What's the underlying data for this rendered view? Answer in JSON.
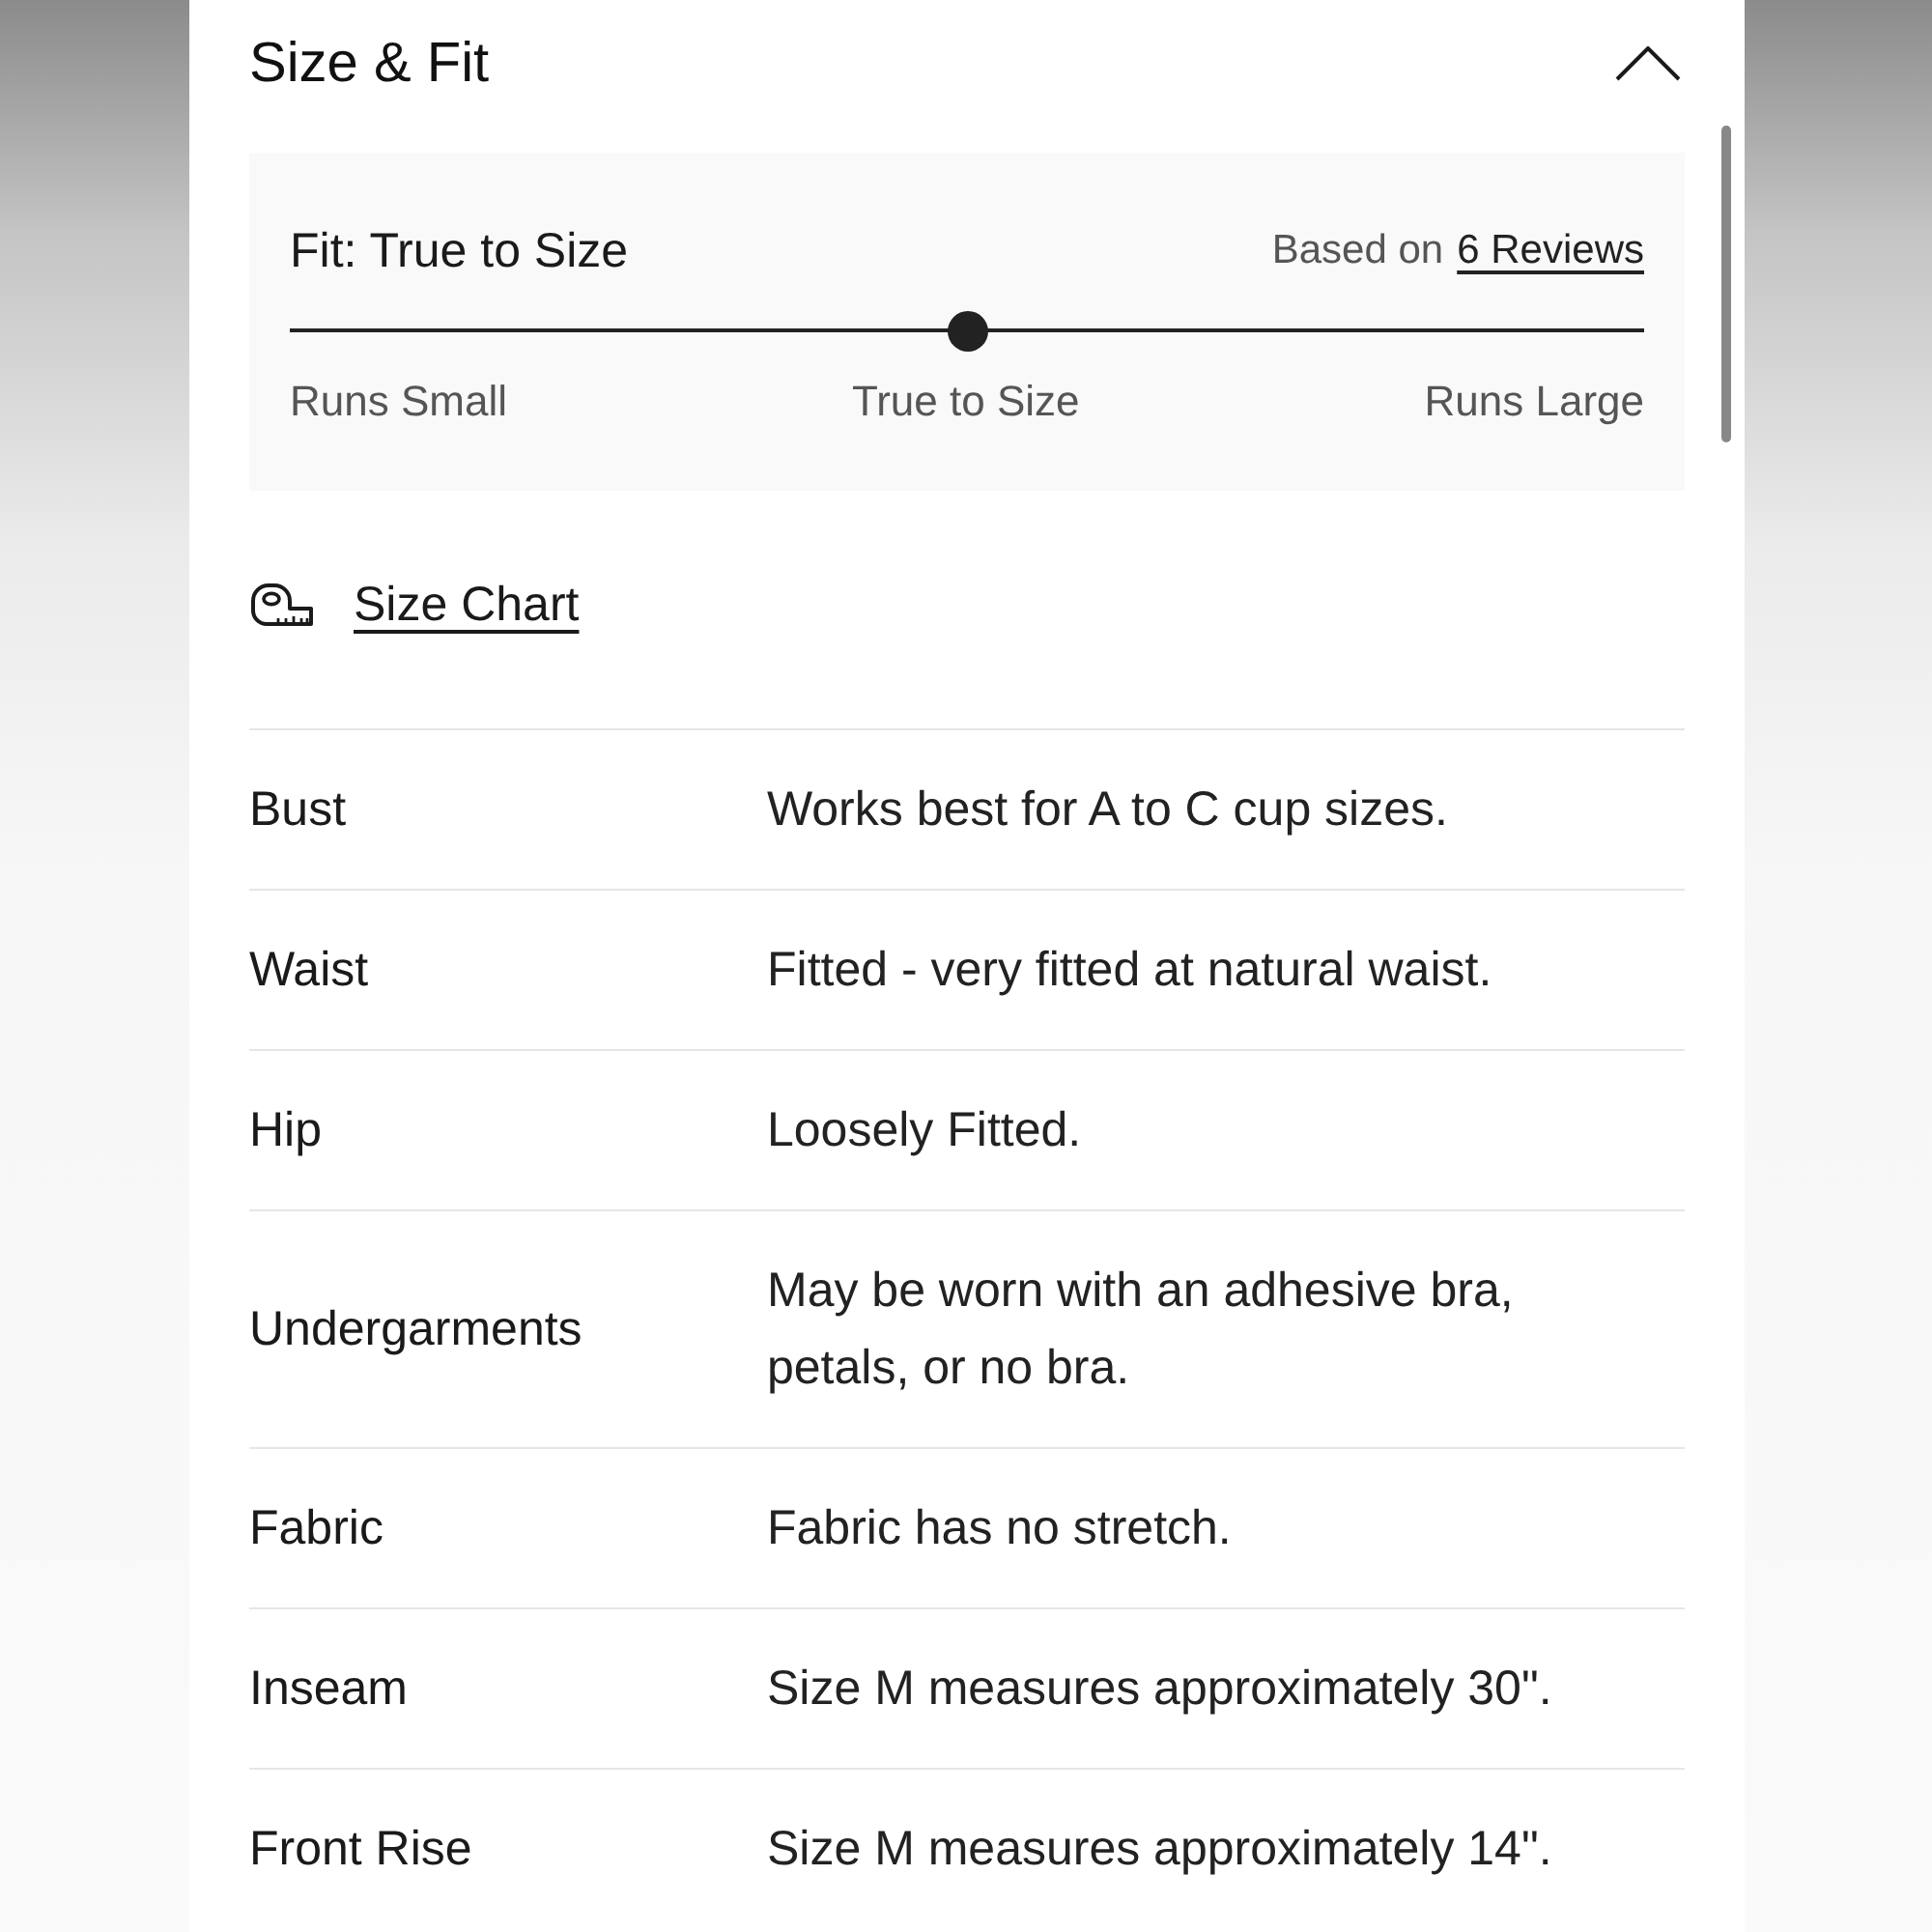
{
  "section": {
    "title": "Size & Fit",
    "expanded": true
  },
  "fit": {
    "title": "Fit: True to Size",
    "based_on": "Based on",
    "reviews_link": "6 Reviews",
    "meter": {
      "level": 0.5
    },
    "scale_labels": [
      "Runs Small",
      "True to Size",
      "Runs Large"
    ]
  },
  "size_chart_link": "Size Chart",
  "details": [
    {
      "label": "Bust",
      "value": "Works best for A to C cup sizes."
    },
    {
      "label": "Waist",
      "value": "Fitted - very fitted at natural waist."
    },
    {
      "label": "Hip",
      "value": "Loosely Fitted."
    },
    {
      "label": "Undergarments",
      "value": "May be worn with an adhesive bra, petals, or no bra."
    },
    {
      "label": "Fabric",
      "value": "Fabric has no stretch."
    },
    {
      "label": "Inseam",
      "value": "Size M measures approximately 30\"."
    },
    {
      "label": "Front Rise",
      "value": "Size M measures approximately 14\"."
    }
  ]
}
